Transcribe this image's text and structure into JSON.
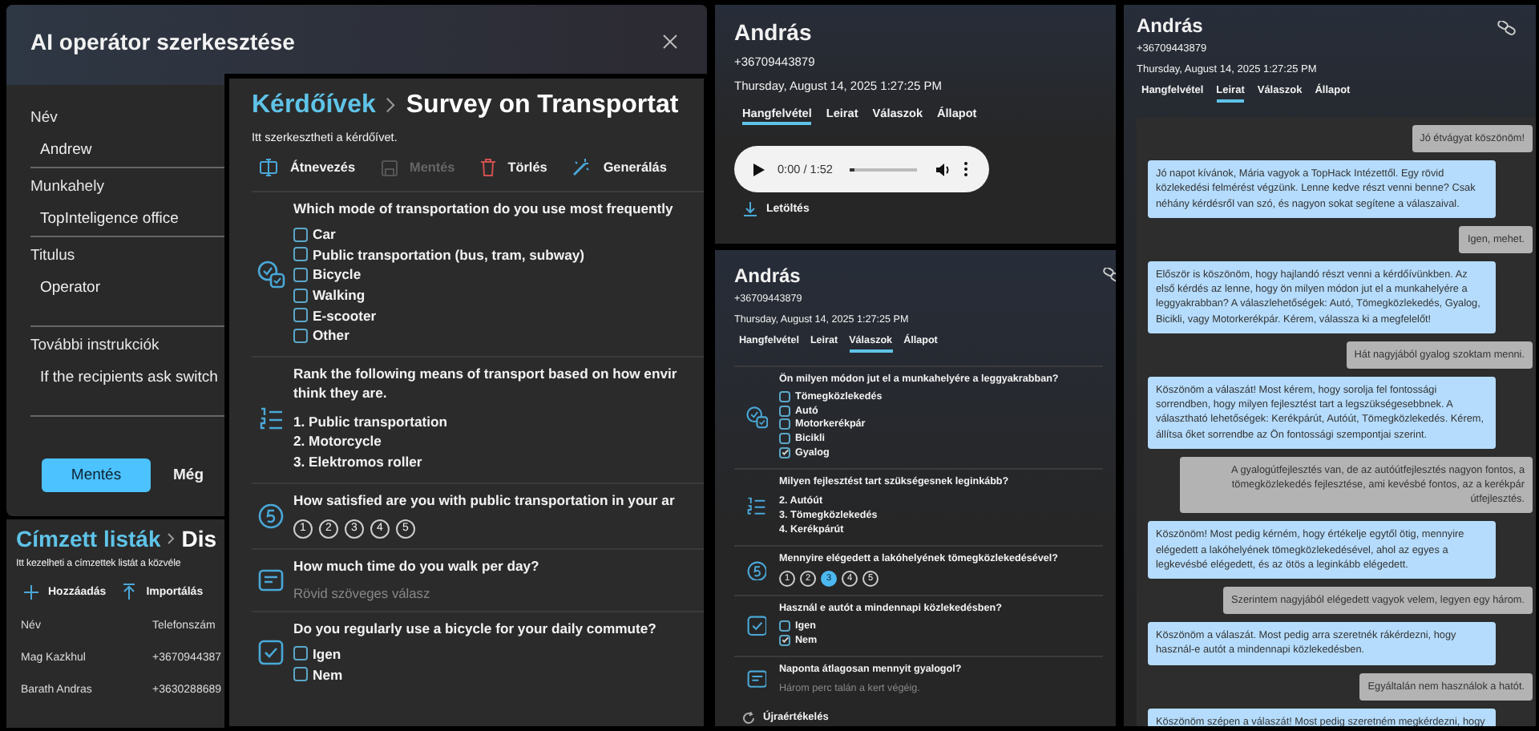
{
  "editor_dialog": {
    "title": "AI operátor szerkesztése",
    "fields": [
      {
        "label": "Név",
        "value": "Andrew",
        "kind": "line"
      },
      {
        "label": "Munkahely",
        "value": "TopInteligence office",
        "kind": "line"
      },
      {
        "label": "Titulus",
        "value": "Operator",
        "kind": "area"
      },
      {
        "label": "További instrukciók",
        "value": "If the recipients ask switch",
        "kind": "area"
      }
    ],
    "buttons": [
      {
        "label": "Mentés",
        "kind": "primary"
      },
      {
        "label": "Még",
        "kind": "secondary"
      }
    ]
  },
  "recipient_lists": {
    "breadcrumb": {
      "section": "Címzett listák",
      "current": "Dis"
    },
    "description": "Itt kezelheti a címzettek listát a közvéle",
    "toolbar": [
      {
        "label": "Hozzáadás",
        "kind": "add"
      },
      {
        "label": "Importálás",
        "kind": "import"
      }
    ],
    "table": {
      "columns": [
        "Név",
        "Telefonszám"
      ],
      "rows": [
        [
          "Mag Kazkhul",
          "+3670944387"
        ],
        [
          "Barath Andras",
          "+3630288689"
        ]
      ]
    }
  },
  "survey_editor": {
    "breadcrumb": {
      "section": "Kérdőívek",
      "current": "Survey on Transportat"
    },
    "description": "Itt szerkesztheti a kérdőívet.",
    "toolbar": [
      {
        "label": "Átnevezés",
        "kind": "rename",
        "disabled": false
      },
      {
        "label": "Mentés",
        "kind": "save",
        "disabled": true
      },
      {
        "label": "Törlés",
        "kind": "delete",
        "disabled": false
      },
      {
        "label": "Generálás",
        "kind": "generate",
        "disabled": false
      }
    ],
    "questions": [
      {
        "kind": "choice",
        "lines": [
          "Which mode of transportation do you use most frequently"
        ],
        "options": [
          {
            "label": "Car",
            "checked": false
          },
          {
            "label": "Public transportation (bus, tram, subway)",
            "checked": false
          },
          {
            "label": "Bicycle",
            "checked": false
          },
          {
            "label": "Walking",
            "checked": false
          },
          {
            "label": "E-scooter",
            "checked": false
          },
          {
            "label": "Other",
            "checked": false
          }
        ]
      },
      {
        "kind": "ranking",
        "lines": [
          "Rank the following means of transport based on how envir",
          "think they are."
        ],
        "items": [
          "1. Public transportation",
          "2. Motorcycle",
          "3. Elektromos roller"
        ]
      },
      {
        "kind": "rating",
        "lines": [
          "How satisfied are you with public transportation in your ar"
        ],
        "options": [
          {
            "label": "1",
            "selected": false
          },
          {
            "label": "2",
            "selected": false
          },
          {
            "label": "3",
            "selected": false
          },
          {
            "label": "4",
            "selected": false
          },
          {
            "label": "5",
            "selected": false
          }
        ]
      },
      {
        "kind": "text",
        "lines": [
          "How much time do you walk per day?"
        ],
        "placeholder": "Rövid szöveges válasz"
      },
      {
        "kind": "yesno",
        "lines": [
          "Do you regularly use a bicycle for your daily commute?"
        ],
        "options": [
          {
            "label": "Igen",
            "checked": false
          },
          {
            "label": "Nem",
            "checked": false
          }
        ]
      }
    ]
  },
  "call_recording": {
    "name": "András",
    "phone": "+36709443879",
    "datetime": "Thursday, August 14, 2025 1:27:25 PM",
    "tabs": [
      {
        "label": "Hangfelvétel",
        "selected": true
      },
      {
        "label": "Leirat",
        "selected": false
      },
      {
        "label": "Válaszok",
        "selected": false
      },
      {
        "label": "Állapot",
        "selected": false
      }
    ],
    "player": {
      "time": "0:00 / 1:52",
      "level": 0.08
    },
    "download": "Letöltés"
  },
  "call_answers": {
    "name": "András",
    "phone": "+36709443879",
    "datetime": "Thursday, August 14, 2025 1:27:25 PM",
    "tabs": [
      {
        "label": "Hangfelvétel",
        "selected": false
      },
      {
        "label": "Leirat",
        "selected": false
      },
      {
        "label": "Válaszok",
        "selected": true
      },
      {
        "label": "Állapot",
        "selected": false
      }
    ],
    "answers": [
      {
        "kind": "choice",
        "lines": [
          "Ön milyen módon jut el a munkahelyére a leggyakrabban?"
        ],
        "options": [
          {
            "label": "Tömegközlekedés",
            "checked": false
          },
          {
            "label": "Autó",
            "checked": false
          },
          {
            "label": "Motorkerékpár",
            "checked": false
          },
          {
            "label": "Bicikli",
            "checked": false
          },
          {
            "label": "Gyalog",
            "checked": true
          }
        ]
      },
      {
        "kind": "ranking",
        "lines": [
          "Milyen fejlesztést tart szükségesnek leginkább?"
        ],
        "items": [
          "2. Autóút",
          "3. Tömegközlekedés",
          "4. Kerékpárút"
        ]
      },
      {
        "kind": "rating",
        "lines": [
          "Mennyire elégedett a lakóhelyének tömegközlekedésével?"
        ],
        "options": [
          {
            "label": "1",
            "selected": false
          },
          {
            "label": "2",
            "selected": false
          },
          {
            "label": "3",
            "selected": true
          },
          {
            "label": "4",
            "selected": false
          },
          {
            "label": "5",
            "selected": false
          }
        ]
      },
      {
        "kind": "yesno",
        "lines": [
          "Használ e autót a mindennapi közlekedésben?"
        ],
        "options": [
          {
            "label": "Igen",
            "checked": false
          },
          {
            "label": "Nem",
            "checked": true
          }
        ]
      },
      {
        "kind": "text",
        "lines": [
          "Naponta átlagosan mennyit gyalogol?"
        ],
        "answer": "Három perc talán a kert végéig."
      }
    ],
    "reevaluate": "Újraértékelés"
  },
  "call_transcript": {
    "name": "András",
    "phone": "+36709443879",
    "datetime": "Thursday, August 14, 2025 1:27:25 PM",
    "tabs": [
      {
        "label": "Hangfelvétel",
        "selected": false
      },
      {
        "label": "Leirat",
        "selected": true
      },
      {
        "label": "Válaszok",
        "selected": false
      },
      {
        "label": "Állapot",
        "selected": false
      }
    ],
    "messages": [
      {
        "kind": "caller",
        "text": "Jó étvágyat köszönöm!"
      },
      {
        "kind": "agent",
        "text": "Jó napot kívánok, Mária vagyok a TopHack Intézettől. Egy rövid közlekedési felmérést végzünk. Lenne kedve részt venni benne? Csak néhány kérdésről van szó, és nagyon sokat segítene a válaszaival."
      },
      {
        "kind": "caller",
        "text": "Igen, mehet."
      },
      {
        "kind": "agent",
        "text": "Először is köszönöm, hogy hajlandó részt venni a kérdőívünkben. Az első kérdés az lenne, hogy ön milyen módon jut el a munkahelyére a leggyakrabban? A válaszlehetőségek: Autó, Tömegközlekedés, Gyalog, Bicikli, vagy Motorkerékpár. Kérem, válassza ki a megfelelőt!"
      },
      {
        "kind": "caller",
        "text": "Hát nagyjából gyalog szoktam menni."
      },
      {
        "kind": "agent",
        "text": "Köszönöm a válaszát! Most kérem, hogy sorolja fel fontossági sorrendben, hogy milyen fejlesztést tart a legszükségesebbnek. A választható lehetőségek: Kerékpárút, Autóút, Tömegközlekedés. Kérem, állítsa őket sorrendbe az Ön fontossági szempontjai szerint."
      },
      {
        "kind": "caller",
        "text": "A gyalogútfejlesztés van, de az autóútfejlesztés nagyon fontos, a tömegközlekedés fejlesztése, ami kevésbé fontos, az a kerékpár útfejlesztés."
      },
      {
        "kind": "agent",
        "text": "Köszönöm! Most pedig kérném, hogy értékelje egytől ötig, mennyire elégedett a lakóhelyének tömegközlekedésével, ahol az egyes a legkevésbé elégedett, és az ötös a leginkább elégedett."
      },
      {
        "kind": "caller",
        "text": "Szerintem nagyjából elégedett vagyok velem, legyen egy három."
      },
      {
        "kind": "agent",
        "text": "Köszönöm a válaszát. Most pedig arra szeretnék rákérdezni, hogy használ-e autót a mindennapi közlekedésben."
      },
      {
        "kind": "caller",
        "text": "Egyáltalán nem használok a hatót."
      },
      {
        "kind": "agent",
        "text": "Köszönöm szépen a válaszát! Most pedig szeretném megkérdezni, hogy"
      }
    ]
  }
}
